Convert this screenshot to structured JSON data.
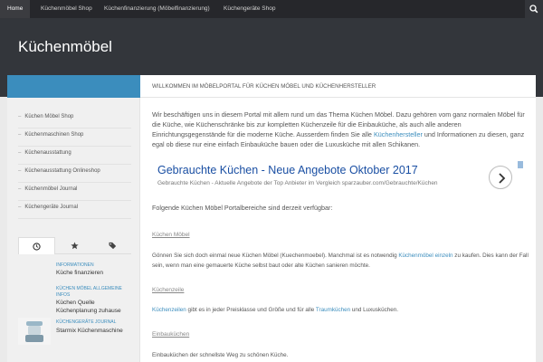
{
  "topnav": {
    "items": [
      "Home",
      "Küchenmöbel Shop",
      "Küchenfinanzierung (Möbelfinanzierung)",
      "Küchengeräte Shop"
    ]
  },
  "header": {
    "site_title": "Küchenmöbel"
  },
  "sidebar": {
    "items": [
      "Küchen Möbel Shop",
      "Küchenmaschinen Shop",
      "Küchenausstattung",
      "Küchenausstattung Onlineshop",
      "Küchenmöbel Journal",
      "Küchengeräte Journal"
    ],
    "posts": [
      {
        "category": "INFORMATIONEN",
        "title": "Küche finanzieren"
      },
      {
        "category": "KÜCHEN MÖBEL ALLGEMEINE INFOS",
        "title": "Küchen Quelle Küchenplanung zuhause"
      },
      {
        "category": "KÜCHENGERÄTE JOURNAL",
        "title": "Starmix Küchenmaschine"
      }
    ]
  },
  "main": {
    "heading": "WILLKOMMEN IM MÖBELPORTAL FÜR KÜCHEN MÖBEL UND KÜCHENHERSTELLER",
    "intro_1": "Wir beschäftigen uns in diesem Portal mit allem rund um das Thema Küchen Möbel. Dazu gehören vom ganz normalen Möbel für die Küche, wie Küchenschränke bis zur kompletten Küchenzeile für die Einbauküche, als auch alle anderen Einrichtungsgegenstände für die moderne Küche. Ausserdem finden Sie alle ",
    "intro_link": "Küchenhersteller",
    "intro_2": " und Informationen zu diesen, ganz egal ob diese nur eine einfach Einbauküche bauen oder die Luxusküche mit allen Schikanen.",
    "ad": {
      "title": "Gebrauchte Küchen - Neue Angebote Oktober 2017",
      "subtitle": "Gebrauchte Küchen - Aktuelle Angebote der Top Anbieter im Vergleich sparzauber.com/Gebrauchte/Küchen"
    },
    "lead": "Folgende Küchen Möbel Portalbereiche sind derzeit verfügbar:",
    "sections": [
      {
        "heading": "Küchen Möbel",
        "text_1": "Gönnen Sie sich doch einmal neue Küchen Möbel (Kuechenmoebel). Manchmal ist es notwendig ",
        "link_1": "Küchenmöbel einzeln",
        "text_2": " zu kaufen. Dies kann der Fall sein, wenn man eine gemauerte Küche selbst baut oder alte Küchen sanieren möchte."
      },
      {
        "heading": "Küchenzeile",
        "link_1": "Küchenzeilen",
        "text_2": " gibt es in jeder Preisklasse und Größe und für alle ",
        "link_2": "Traumküchen",
        "text_3": " und Luxusküchen."
      },
      {
        "heading": "Einbauküchen",
        "text_1": "Einbauküchen der schnellste Weg zu schönen Küche."
      }
    ]
  }
}
